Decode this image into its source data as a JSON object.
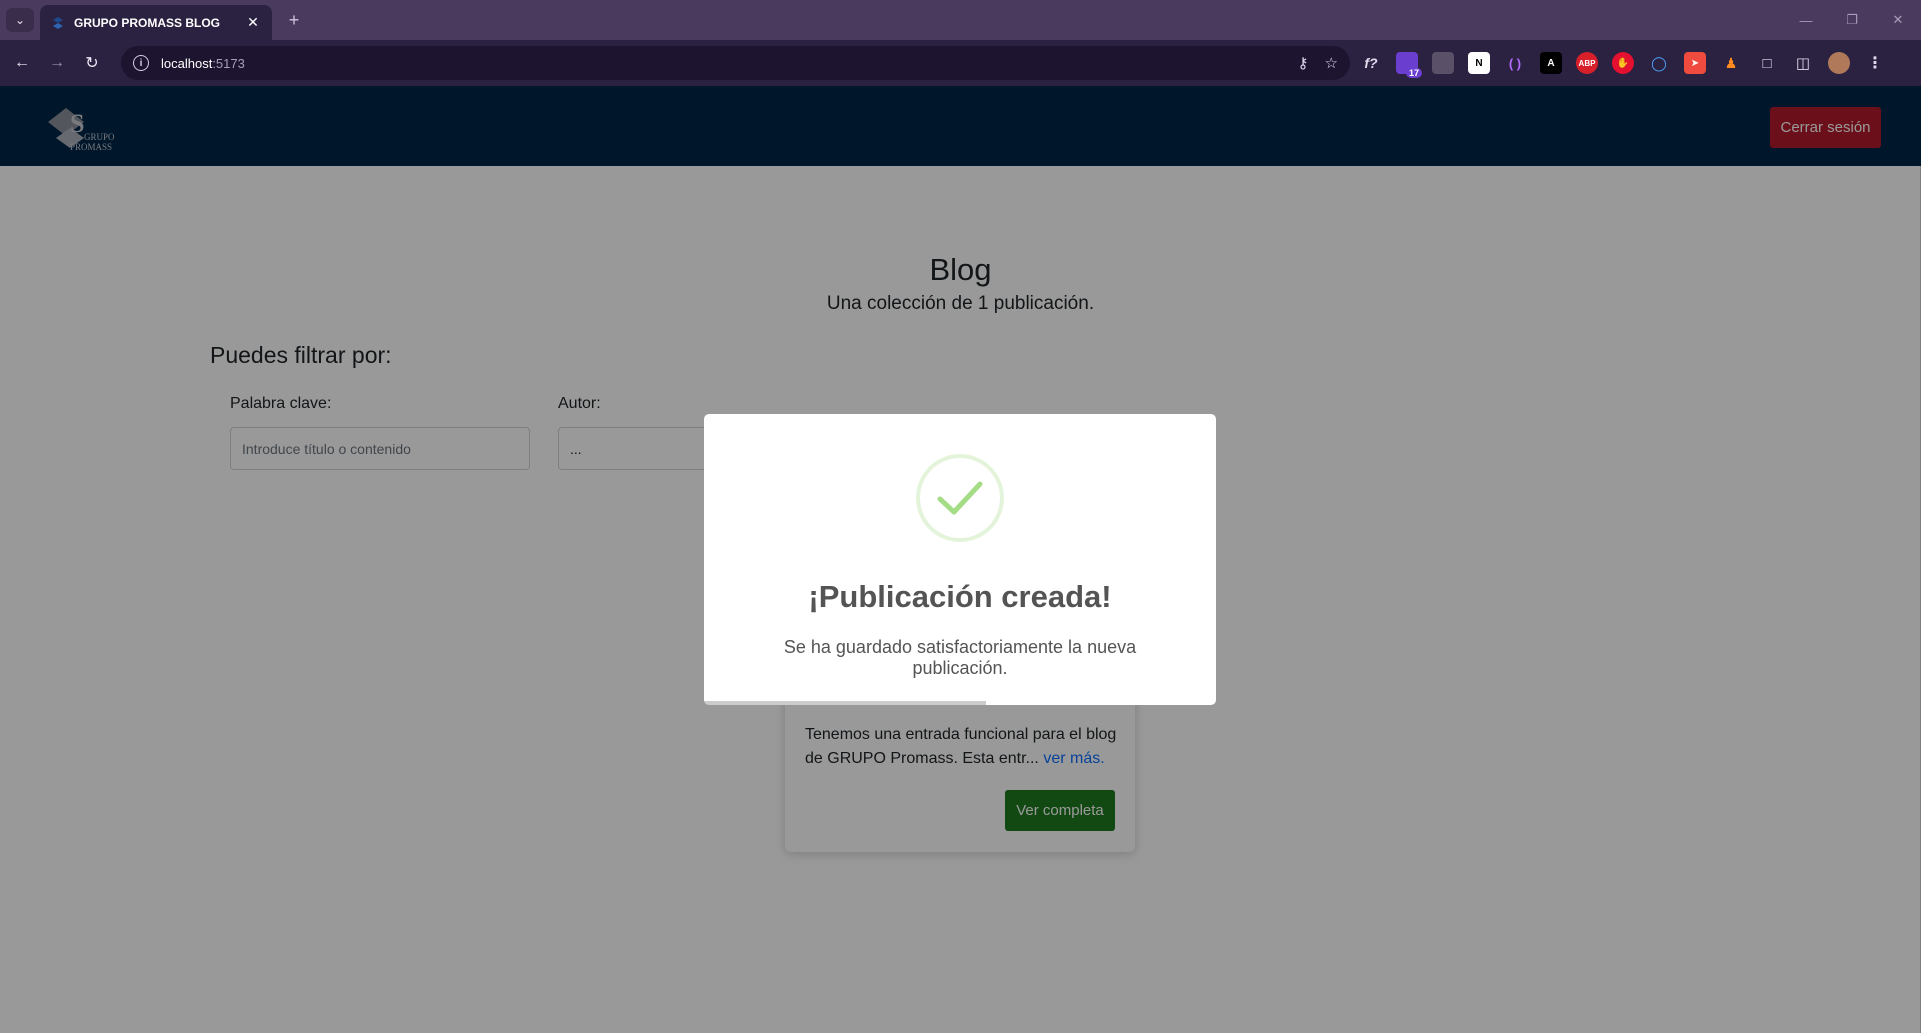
{
  "browser": {
    "tab_title": "GRUPO PROMASS BLOG",
    "url_host": "localhost",
    "url_port": ":5173",
    "extension_badge": "17"
  },
  "header": {
    "logo_line1": "GRUPO",
    "logo_line2": "PROMASS",
    "logout_label": "Cerrar sesión"
  },
  "main": {
    "title": "Blog",
    "subtitle": "Una colección de 1 publicación.",
    "filter_heading": "Puedes filtrar por:",
    "keyword_label": "Palabra clave:",
    "keyword_placeholder": "Introduce título o contenido",
    "author_label": "Autor:",
    "author_value": "..."
  },
  "post": {
    "excerpt": "Tenemos una entrada funcional para el blog de GRUPO Promass. Esta entr...",
    "more_link": "ver más.",
    "button_label": "Ver completa"
  },
  "modal": {
    "title": "¡Publicación creada!",
    "text": "Se ha guardado satisfactoriamente la nueva publicación.",
    "timer_progress": 0.55,
    "icon_color": "#a5dc86"
  },
  "colors": {
    "header_bg": "#002649",
    "logout_bg": "#b31b2c",
    "post_button_bg": "#1f7a1f",
    "link": "#0d6efd"
  }
}
